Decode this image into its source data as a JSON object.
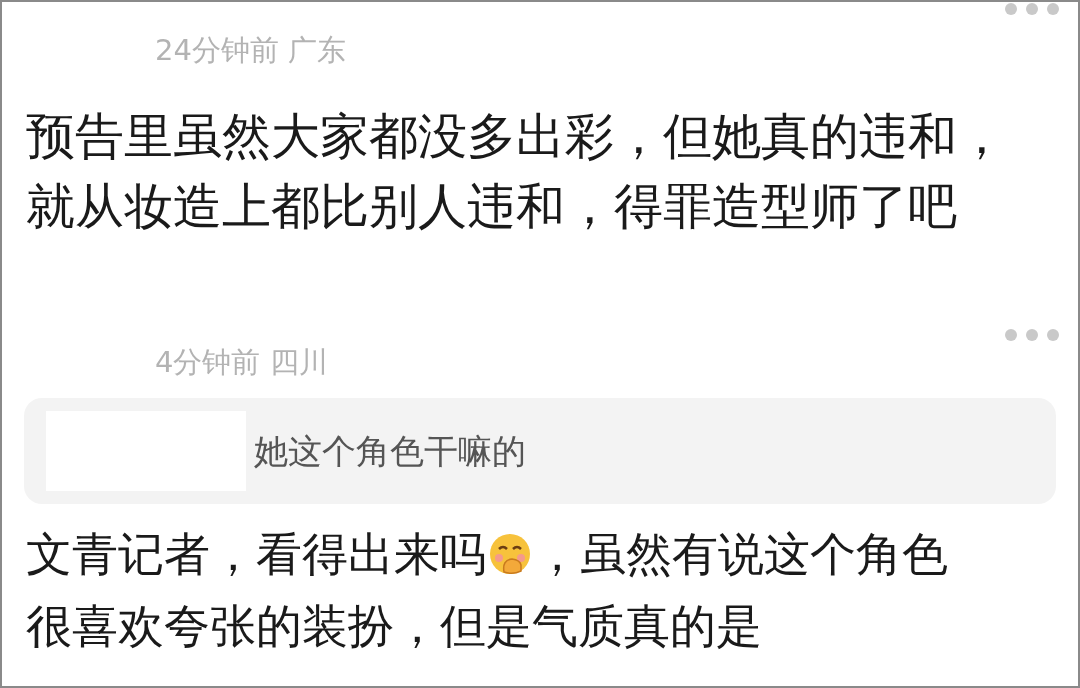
{
  "comments": [
    {
      "meta": "24分钟前 广东",
      "body": "预告里虽然大家都没多出彩，但她真的违和，就从妆造上都比别人违和，得罪造型师了吧"
    },
    {
      "meta": "4分钟前 四川",
      "quote": {
        "text": "她这个角色干嘛的",
        "redacted": true
      },
      "body_lines": [
        {
          "segments": [
            {
              "kind": "text",
              "text": "文青记者，看得出来吗"
            },
            {
              "kind": "emoji"
            },
            {
              "kind": "text",
              "text": "，虽然有说这个角色"
            }
          ]
        },
        {
          "segments": [
            {
              "kind": "text",
              "text": "很喜欢夸张的装扮，但是气质真的是"
            }
          ]
        }
      ]
    }
  ]
}
